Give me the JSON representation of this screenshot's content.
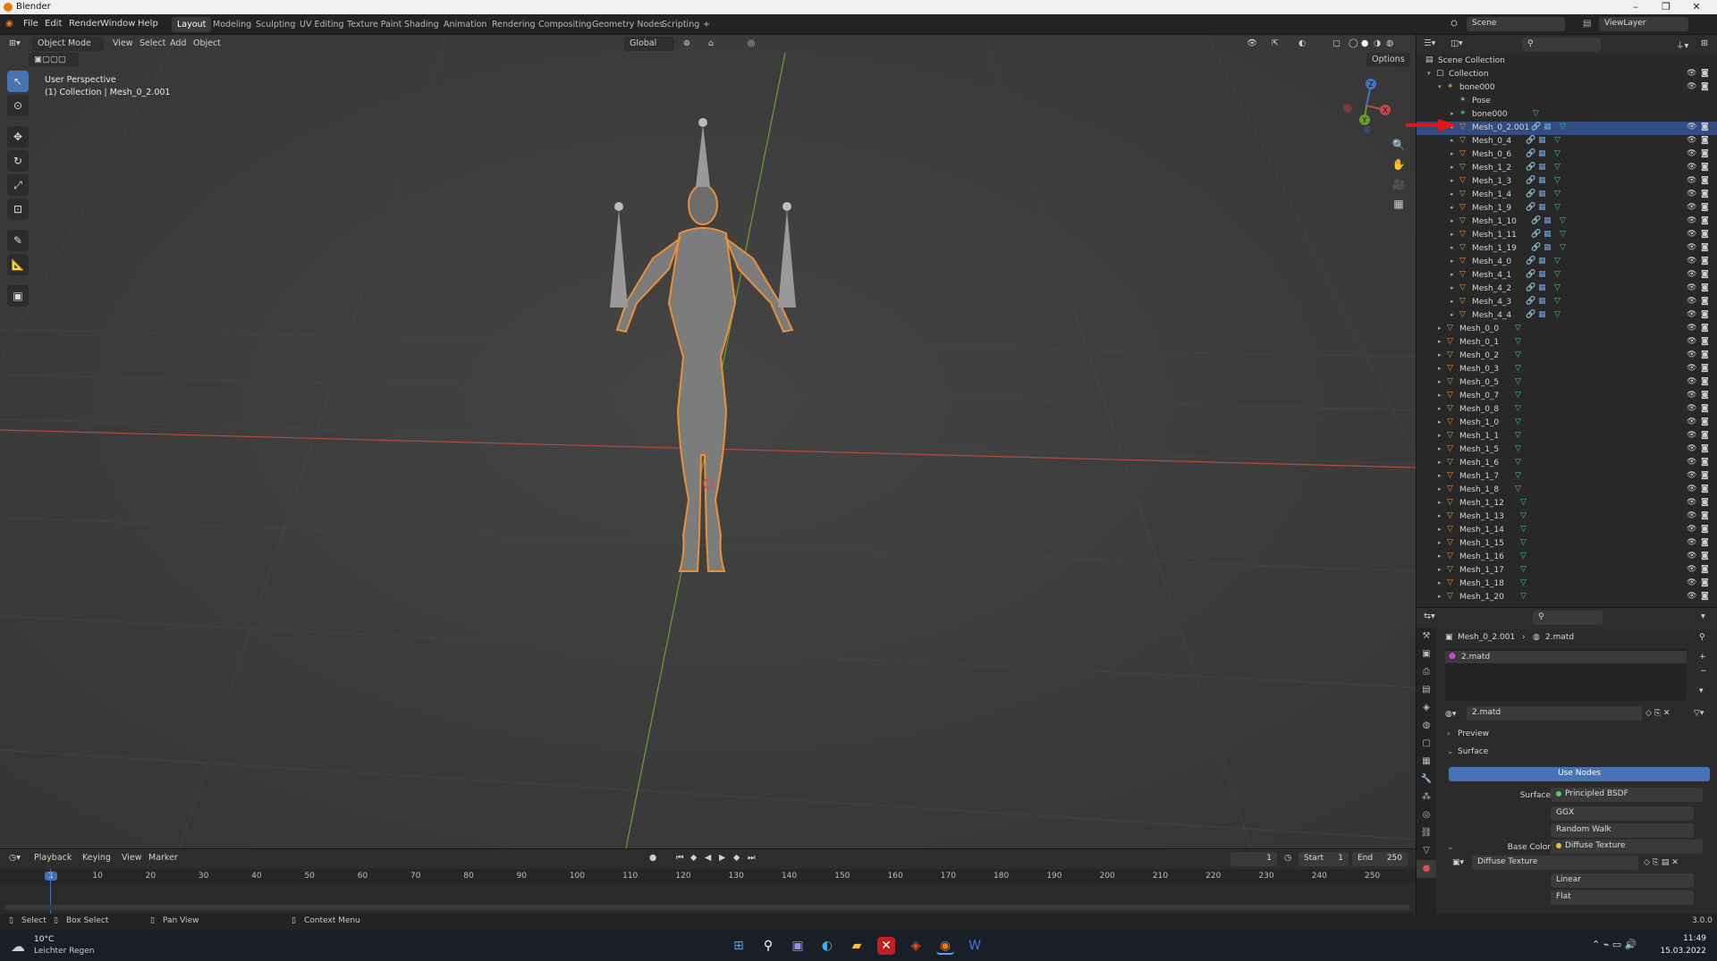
{
  "os": {
    "window_title": "Blender",
    "minimize": "–",
    "maximize": "❐",
    "close": "✕"
  },
  "menu": [
    "File",
    "Edit",
    "Render",
    "Window",
    "Help"
  ],
  "workspaces": [
    "Layout",
    "Modeling",
    "Sculpting",
    "UV Editing",
    "Texture Paint",
    "Shading",
    "Animation",
    "Rendering",
    "Compositing",
    "Geometry Nodes",
    "Scripting"
  ],
  "workspace_add": "+",
  "scene": {
    "name": "Scene",
    "view_layer": "ViewLayer"
  },
  "viewport": {
    "mode": "Object Mode",
    "menus": [
      "View",
      "Select",
      "Add",
      "Object"
    ],
    "orientation": "Global",
    "options": "Options",
    "perspective": "User Perspective",
    "context": "(1) Collection | Mesh_0_2.001",
    "axis_labels": {
      "x": "X",
      "y": "Y",
      "z": "Z"
    }
  },
  "timeline": {
    "menus": [
      "Playback",
      "Keying",
      "View",
      "Marker"
    ],
    "current_frame": "1",
    "start_label": "Start",
    "start": "1",
    "end_label": "End",
    "end": "250",
    "ticks": [
      "1",
      "10",
      "20",
      "30",
      "40",
      "50",
      "60",
      "70",
      "80",
      "90",
      "100",
      "110",
      "120",
      "130",
      "140",
      "150",
      "160",
      "170",
      "180",
      "190",
      "200",
      "210",
      "220",
      "230",
      "240",
      "250"
    ]
  },
  "outliner": {
    "scene_collection": "Scene Collection",
    "collection": "Collection",
    "armature": "bone000",
    "pose": "Pose",
    "bone": "bone000",
    "selected": "Mesh_0_2.001",
    "child_meshes": [
      "Mesh_0_4",
      "Mesh_0_6",
      "Mesh_1_2",
      "Mesh_1_3",
      "Mesh_1_4",
      "Mesh_1_9",
      "Mesh_1_10",
      "Mesh_1_11",
      "Mesh_1_19",
      "Mesh_4_0",
      "Mesh_4_1",
      "Mesh_4_2",
      "Mesh_4_3",
      "Mesh_4_4"
    ],
    "meshes": [
      "Mesh_0_0",
      "Mesh_0_1",
      "Mesh_0_2",
      "Mesh_0_3",
      "Mesh_0_5",
      "Mesh_0_7",
      "Mesh_0_8",
      "Mesh_1_0",
      "Mesh_1_1",
      "Mesh_1_5",
      "Mesh_1_6",
      "Mesh_1_7",
      "Mesh_1_8",
      "Mesh_1_12",
      "Mesh_1_13",
      "Mesh_1_14",
      "Mesh_1_15",
      "Mesh_1_16",
      "Mesh_1_17",
      "Mesh_1_18",
      "Mesh_1_20"
    ]
  },
  "properties": {
    "breadcrumb_object": "Mesh_0_2.001",
    "breadcrumb_material": "2.matd",
    "slot": "2.matd",
    "material": "2.matd",
    "preview": "Preview",
    "surface_panel": "Surface",
    "use_nodes": "Use Nodes",
    "surface_label": "Surface",
    "surface_value": "Principled BSDF",
    "distribution": "GGX",
    "subsurface": "Random Walk",
    "base_color_label": "Base Color",
    "base_color_value": "Diffuse Texture",
    "texture_name": "Diffuse Texture",
    "interpolation": "Linear",
    "projection": "Flat"
  },
  "statusbar": {
    "select": "Select",
    "box_select": "Box Select",
    "pan_view": "Pan View",
    "context_menu": "Context Menu",
    "version": "3.0.0"
  },
  "taskbar": {
    "temp": "10°C",
    "weather": "Leichter Regen",
    "time": "11:49",
    "date": "15.03.2022"
  },
  "colors": {
    "accent": "#4772b3",
    "selection_outline": "#e8913a",
    "x_axis": "#c0392b",
    "y_axis": "#6a9a2e",
    "arrow": "#e0161b"
  }
}
